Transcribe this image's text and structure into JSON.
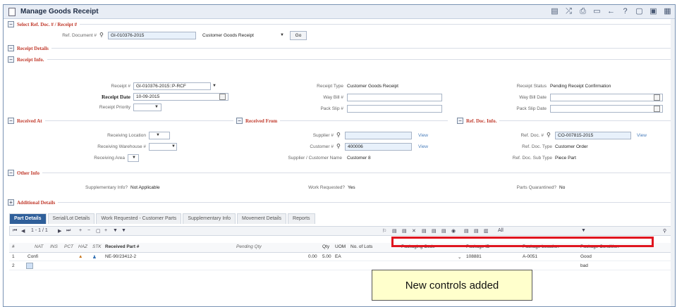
{
  "window": {
    "title": "Manage Goods Receipt"
  },
  "sections": {
    "select_ref": "Select Ref. Doc. # / Receipt #",
    "receipt_details": "Receipt Details",
    "receipt_info": "Receipt Info.",
    "received_at": "Received At",
    "received_from": "Received From",
    "ref_doc_info": "Ref. Doc. Info.",
    "other_info": "Other Info",
    "additional_details": "Additional Details"
  },
  "select_ref": {
    "ref_doc_label": "Ref. Document #",
    "ref_doc_value": "GI-010376-2015",
    "type_value": "Customer Goods Receipt",
    "go_label": "Go"
  },
  "receipt_info": {
    "receipt_label": "Receipt #",
    "receipt_value": "GI-010376-2015::P-RCF",
    "receipt_date_label": "Receipt Date",
    "receipt_date_value": "10-09-2015",
    "receipt_priority_label": "Receipt Priority",
    "receipt_type_label": "Receipt Type",
    "receipt_type_value": "Customer Goods Receipt",
    "way_bill_label": "Way Bill #",
    "pack_slip_label": "Pack Slip #",
    "receipt_status_label": "Receipt Status",
    "receipt_status_value": "Pending Receipt Confirmation",
    "way_bill_date_label": "Way Bill Date",
    "pack_slip_date_label": "Pack Slip Date"
  },
  "received_at": {
    "receiving_location_label": "Receiving Location",
    "receiving_warehouse_label": "Receiving Warehouse #",
    "receiving_area_label": "Receiving Area"
  },
  "received_from": {
    "supplier_label": "Supplier #",
    "customer_label": "Customer #",
    "customer_value": "400006",
    "name_label": "Supplier / Customer Name",
    "name_value": "Customer 8",
    "view_label": "View"
  },
  "ref_doc_info": {
    "ref_doc_label": "Ref. Doc. #",
    "ref_doc_value": "CO-007815-2015",
    "ref_doc_type_label": "Ref. Doc. Type",
    "ref_doc_type_value": "Customer Order",
    "ref_doc_sub_type_label": "Ref. Doc. Sub Type",
    "ref_doc_sub_type_value": "Piece Part",
    "view_label": "View"
  },
  "other_info": {
    "supplementary_label": "Supplementary Info?",
    "supplementary_value": "Not Applicable",
    "work_requested_label": "Work Requested?",
    "work_requested_value": "Yes",
    "parts_quarantined_label": "Parts Quarantined?",
    "parts_quarantined_value": "No"
  },
  "tabs": [
    "Part Details",
    "Serial/Lot Details",
    "Work Requested - Customer Parts",
    "Supplementary Info",
    "Movement Details",
    "Reports"
  ],
  "grid": {
    "pager": "1 - 1 / 1",
    "filter_value": "All",
    "headers": [
      "#",
      "NAT",
      "INS",
      "PCT",
      "HAZ",
      "STK",
      "Received Part #",
      "Pending Qty",
      "Qty",
      "UOM",
      "No. of Lots",
      "Packaging Code",
      "Package ID",
      "Package Location",
      "Package Condition"
    ],
    "rows": [
      {
        "num": "1",
        "status": "Confi",
        "part": "NE-90/23412-2",
        "pending": "0.00",
        "qty": "5.00",
        "uom": "EA",
        "package_id": "108881",
        "package_location": "A-0051",
        "package_condition": "Good"
      },
      {
        "num": "2",
        "package_condition": "bad"
      }
    ]
  },
  "callout": {
    "text": "New controls added"
  }
}
